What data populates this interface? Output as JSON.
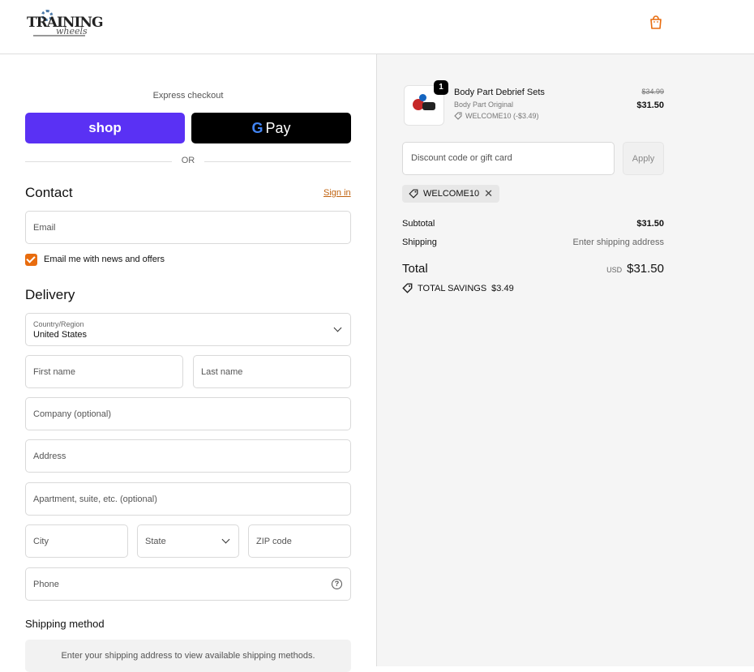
{
  "header": {
    "logo_text": "TRAINING",
    "logo_subtext": "wheels"
  },
  "express": {
    "label": "Express checkout",
    "shop_pay_label": "shop",
    "gpay_g": "G",
    "gpay_label": "Pay",
    "or_label": "OR"
  },
  "contact": {
    "title": "Contact",
    "sign_in": "Sign in",
    "email_placeholder": "Email",
    "marketing_label": "Email me with news and offers"
  },
  "delivery": {
    "title": "Delivery",
    "country_label": "Country/Region",
    "country_value": "United States",
    "first_name": "First name",
    "last_name": "Last name",
    "company": "Company (optional)",
    "address": "Address",
    "apartment": "Apartment, suite, etc. (optional)",
    "city": "City",
    "state": "State",
    "zip": "ZIP code",
    "phone": "Phone",
    "help_glyph": "?"
  },
  "shipping_method": {
    "title": "Shipping method",
    "message": "Enter your shipping address to view available shipping methods."
  },
  "order": {
    "quantity": "1",
    "product_name": "Body Part Debrief Sets",
    "variant": "Body Part Original",
    "discount_line": "WELCOME10 (-$3.49)",
    "original_price": "$34.99",
    "price": "$31.50"
  },
  "discount": {
    "placeholder": "Discount code or gift card",
    "apply": "Apply",
    "applied_code": "WELCOME10",
    "remove_glyph": "✕"
  },
  "summary": {
    "subtotal_label": "Subtotal",
    "subtotal_value": "$31.50",
    "shipping_label": "Shipping",
    "shipping_value": "Enter shipping address",
    "total_label": "Total",
    "currency": "USD",
    "total_value": "$31.50",
    "savings_label": "TOTAL SAVINGS",
    "savings_value": "$3.49"
  },
  "colors": {
    "accent": "#e86c0e",
    "shop_pay": "#5a31f4",
    "link": "#c0620f"
  }
}
